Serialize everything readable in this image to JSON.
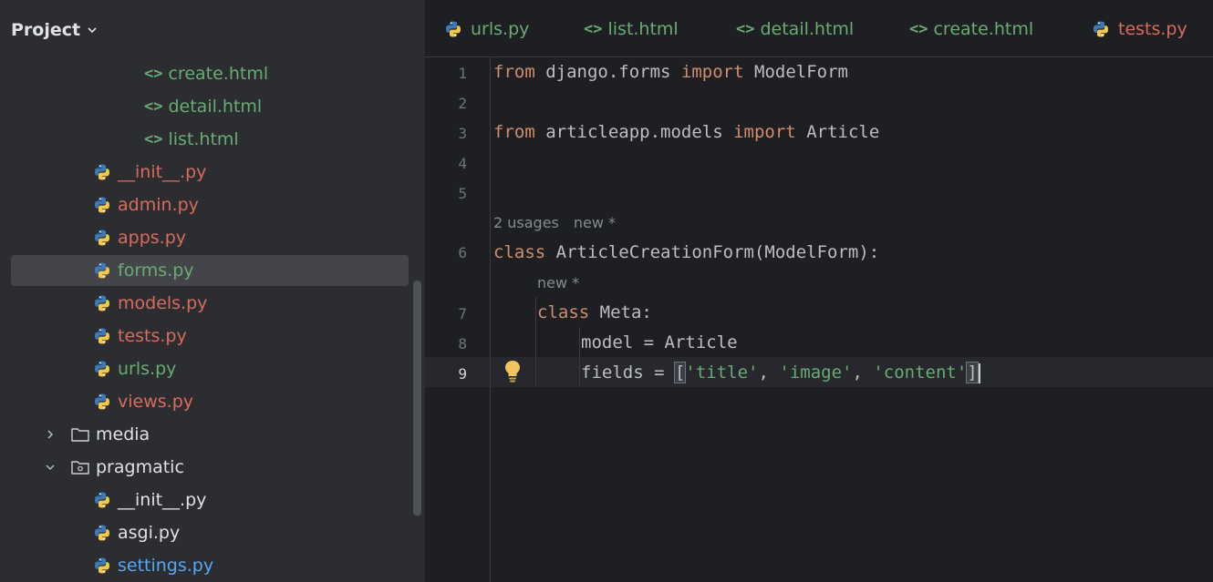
{
  "sidebar": {
    "title": "Project",
    "items": [
      {
        "label": "create.html",
        "type": "html",
        "color": "#6aab73"
      },
      {
        "label": "detail.html",
        "type": "html",
        "color": "#6aab73"
      },
      {
        "label": "list.html",
        "type": "html",
        "color": "#6aab73"
      },
      {
        "label": "__init__.py",
        "type": "py",
        "color": "#d76c5e"
      },
      {
        "label": "admin.py",
        "type": "py",
        "color": "#d76c5e"
      },
      {
        "label": "apps.py",
        "type": "py",
        "color": "#d76c5e"
      },
      {
        "label": "forms.py",
        "type": "py",
        "color": "#6aab73",
        "selected": true
      },
      {
        "label": "models.py",
        "type": "py",
        "color": "#d76c5e"
      },
      {
        "label": "tests.py",
        "type": "py",
        "color": "#d76c5e"
      },
      {
        "label": "urls.py",
        "type": "py",
        "color": "#6aab73"
      },
      {
        "label": "views.py",
        "type": "py",
        "color": "#d76c5e"
      },
      {
        "label": "media",
        "type": "folder",
        "color": "#dfe1e5",
        "expanded": false
      },
      {
        "label": "pragmatic",
        "type": "folder-pkg",
        "color": "#dfe1e5",
        "expanded": true
      },
      {
        "label": "__init__.py",
        "type": "py",
        "color": "#dfe1e5"
      },
      {
        "label": "asgi.py",
        "type": "py",
        "color": "#dfe1e5"
      },
      {
        "label": "settings.py",
        "type": "py",
        "color": "#56a8f5"
      }
    ]
  },
  "tabs": [
    {
      "label": "urls.py",
      "type": "py",
      "color": "#6aab73"
    },
    {
      "label": "list.html",
      "type": "html",
      "color": "#6aab73"
    },
    {
      "label": "detail.html",
      "type": "html",
      "color": "#6aab73"
    },
    {
      "label": "create.html",
      "type": "html",
      "color": "#6aab73"
    },
    {
      "label": "tests.py",
      "type": "py",
      "color": "#d76c5e"
    }
  ],
  "editor": {
    "line_numbers": [
      "1",
      "2",
      "3",
      "4",
      "5",
      "6",
      "7",
      "8",
      "9"
    ],
    "lines": {
      "l1": {
        "kw1": "from",
        "t1": " django.forms ",
        "kw2": "import",
        "t2": " ModelForm"
      },
      "l3": {
        "kw1": "from",
        "t1": " articleapp.models ",
        "kw2": "import",
        "t2": " Article"
      },
      "l6": {
        "kw1": "class",
        "t1": " ArticleCreationForm(ModelForm):"
      },
      "l7": {
        "kw1": "class",
        "t1": " Meta:"
      },
      "l8": {
        "t1": "model = Article"
      },
      "l9": {
        "t1": "fields = ",
        "b1": "[",
        "s1": "'title'",
        "c1": ", ",
        "s2": "'image'",
        "c2": ", ",
        "s3": "'content'",
        "b2": "]"
      }
    },
    "hints": {
      "usages": "2 usages",
      "new1": "new *",
      "new2": "new *"
    }
  },
  "icons": {
    "python": "python-icon",
    "html": "html-icon",
    "folder": "folder-icon",
    "bulb": "lightbulb-icon"
  }
}
